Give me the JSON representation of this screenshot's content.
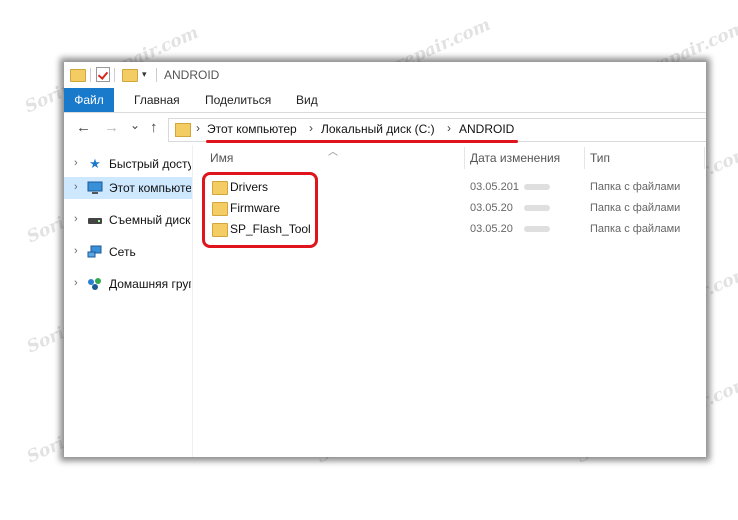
{
  "window": {
    "title": "ANDROID",
    "quick_access_dropdown": "▾"
  },
  "ribbon": {
    "tabs": [
      "Файл",
      "Главная",
      "Поделиться",
      "Вид"
    ]
  },
  "nav": {
    "back": "←",
    "forward": "→",
    "recent": "⌄",
    "up": "↑"
  },
  "address": {
    "crumbs": [
      "Этот компьютер",
      "Локальный диск (C:)",
      "ANDROID"
    ],
    "separator": "›"
  },
  "sidebar": {
    "items": [
      {
        "label": "Быстрый доступ",
        "icon": "star-icon",
        "active": false
      },
      {
        "label": "Этот компьютер",
        "icon": "computer-icon",
        "active": true
      },
      {
        "label": "Съемный диск",
        "icon": "drive-icon",
        "active": false
      },
      {
        "label": "Сеть",
        "icon": "network-icon",
        "active": false
      },
      {
        "label": "Домашняя группа",
        "icon": "homegroup-icon",
        "active": false
      }
    ]
  },
  "columns": {
    "name": "Имя",
    "date": "Дата изменения",
    "type": "Тип"
  },
  "files": [
    {
      "name": "Drivers",
      "date": "03.05.201",
      "type": "Папка с файлами"
    },
    {
      "name": "Firmware",
      "date": "03.05.20",
      "type": "Папка с файлами"
    },
    {
      "name": "SP_Flash_Tool",
      "date": "03.05.20",
      "type": "Папка с файлами"
    }
  ],
  "watermark": "Soringpcrepair.com",
  "colors": {
    "accent": "#1979ca",
    "annotation": "#e0141c",
    "folder": "#f3cd63",
    "selected": "#cde8ff"
  }
}
